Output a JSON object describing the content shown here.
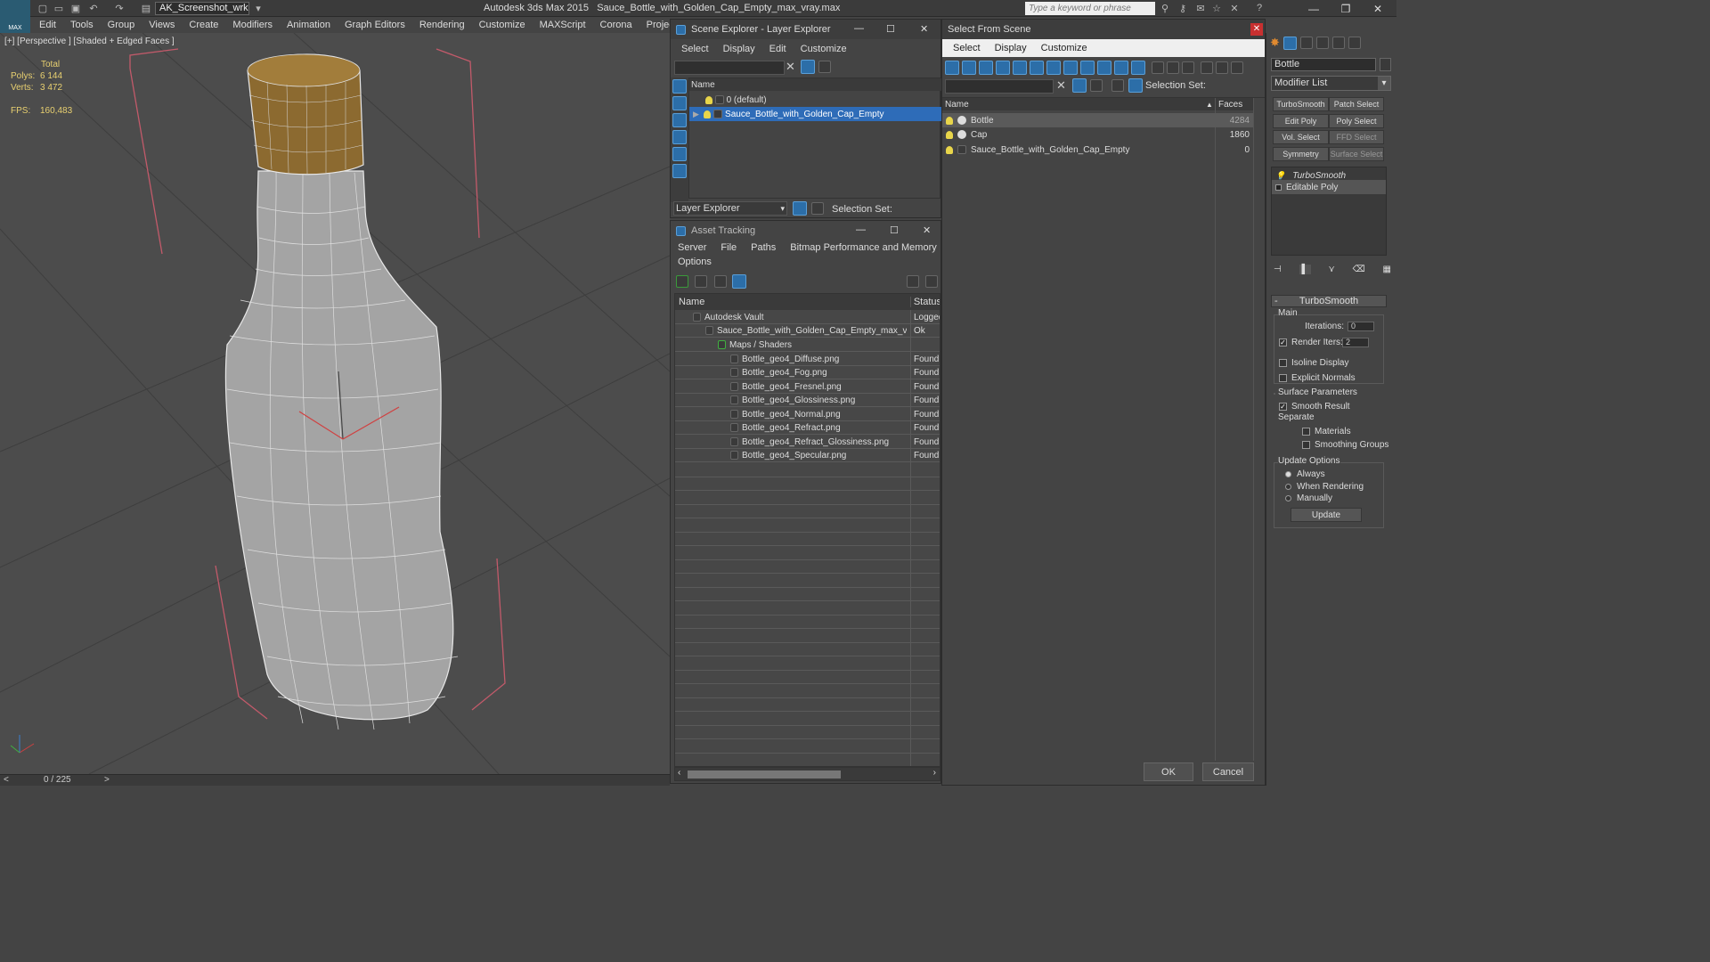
{
  "app": {
    "title": "Autodesk 3ds Max  2015",
    "file": "Sauce_Bottle_with_Golden_Cap_Empty_max_vray.max",
    "logo_text": "MAX",
    "workspace": "AK_Screenshot_wrksp",
    "search_placeholder": "Type a keyword or phrase"
  },
  "menu": [
    "Edit",
    "Tools",
    "Group",
    "Views",
    "Create",
    "Modifiers",
    "Animation",
    "Graph Editors",
    "Rendering",
    "Customize",
    "MAXScript",
    "Corona",
    "Project Man"
  ],
  "viewport": {
    "label": "[+] [Perspective ] [Shaded + Edged Faces ]",
    "stats": {
      "total_label": "Total",
      "polys_label": "Polys:",
      "polys": "6 144",
      "verts_label": "Verts:",
      "verts": "3 472",
      "fps_label": "FPS:",
      "fps": "160,483"
    },
    "time_value": "0 / 225",
    "prev_symbol": "<",
    "next_symbol": ">"
  },
  "scene_explorer": {
    "title": "Scene Explorer - Layer Explorer",
    "menu": [
      "Select",
      "Display",
      "Edit",
      "Customize"
    ],
    "col_name": "Name",
    "rows": [
      "0 (default)",
      "Sauce_Bottle_with_Golden_Cap_Empty"
    ],
    "explorer_label": "Layer Explorer",
    "selection_set_label": "Selection Set:"
  },
  "asset_tracking": {
    "title": "Asset Tracking",
    "menu": [
      "Server",
      "File",
      "Paths",
      "Bitmap Performance and Memory"
    ],
    "menu2": "Options",
    "col_name": "Name",
    "col_status": "Status",
    "rows": [
      {
        "name": "Autodesk Vault",
        "status": "Logged"
      },
      {
        "name": "Sauce_Bottle_with_Golden_Cap_Empty_max_vra...",
        "status": "Ok"
      },
      {
        "name": "Maps / Shaders",
        "status": ""
      },
      {
        "name": "Bottle_geo4_Diffuse.png",
        "status": "Found"
      },
      {
        "name": "Bottle_geo4_Fog.png",
        "status": "Found"
      },
      {
        "name": "Bottle_geo4_Fresnel.png",
        "status": "Found"
      },
      {
        "name": "Bottle_geo4_Glossiness.png",
        "status": "Found"
      },
      {
        "name": "Bottle_geo4_Normal.png",
        "status": "Found"
      },
      {
        "name": "Bottle_geo4_Refract.png",
        "status": "Found"
      },
      {
        "name": "Bottle_geo4_Refract_Glossiness.png",
        "status": "Found"
      },
      {
        "name": "Bottle_geo4_Specular.png",
        "status": "Found"
      }
    ]
  },
  "select_from_scene": {
    "title": "Select From Scene",
    "menu": [
      "Select",
      "Display",
      "Customize"
    ],
    "selection_set_label": "Selection Set:",
    "col_name": "Name",
    "col_faces": "Faces",
    "rows": [
      {
        "name": "Bottle",
        "faces": "4284"
      },
      {
        "name": "Cap",
        "faces": "1860"
      },
      {
        "name": "Sauce_Bottle_with_Golden_Cap_Empty",
        "faces": "0"
      }
    ],
    "ok": "OK",
    "cancel": "Cancel"
  },
  "command_panel": {
    "object_name": "Bottle",
    "modifier_list": "Modifier List",
    "buttons": [
      "TurboSmooth",
      "Patch Select",
      "Edit Poly",
      "Poly Select",
      "Vol. Select",
      "FFD Select",
      "Symmetry",
      "Surface Select"
    ],
    "stack": [
      "TurboSmooth",
      "Editable Poly"
    ],
    "rollout_title": "TurboSmooth",
    "main_label": "Main",
    "iterations_label": "Iterations:",
    "iterations": "0",
    "render_iters_label": "Render Iters:",
    "render_iters": "2",
    "isoline": "Isoline Display",
    "explicit_normals": "Explicit Normals",
    "surface_params": "Surface Parameters",
    "smooth_result": "Smooth Result",
    "separate": "Separate",
    "materials": "Materials",
    "smoothing_groups": "Smoothing Groups",
    "update_options": "Update Options",
    "always": "Always",
    "when_rendering": "When Rendering",
    "manually": "Manually",
    "update": "Update"
  }
}
